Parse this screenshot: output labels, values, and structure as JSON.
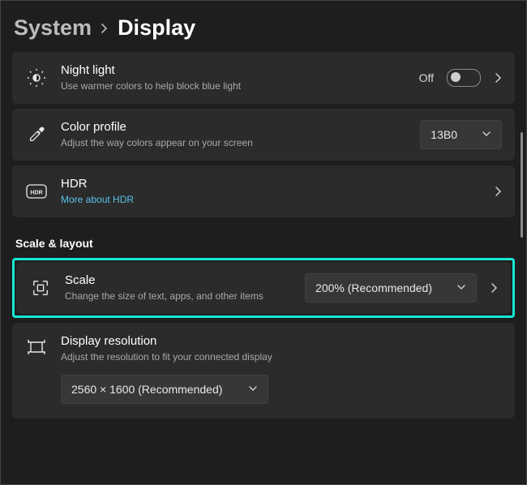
{
  "breadcrumb": {
    "parent": "System",
    "current": "Display"
  },
  "cards": {
    "night_light": {
      "title": "Night light",
      "subtitle": "Use warmer colors to help block blue light",
      "toggle_state": "Off"
    },
    "color_profile": {
      "title": "Color profile",
      "subtitle": "Adjust the way colors appear on your screen",
      "value": "13B0"
    },
    "hdr": {
      "title": "HDR",
      "link": "More about HDR"
    }
  },
  "section": {
    "scale_layout": "Scale & layout"
  },
  "scale": {
    "title": "Scale",
    "subtitle": "Change the size of text, apps, and other items",
    "value": "200% (Recommended)"
  },
  "resolution": {
    "title": "Display resolution",
    "subtitle": "Adjust the resolution to fit your connected display",
    "value": "2560 × 1600 (Recommended)"
  }
}
